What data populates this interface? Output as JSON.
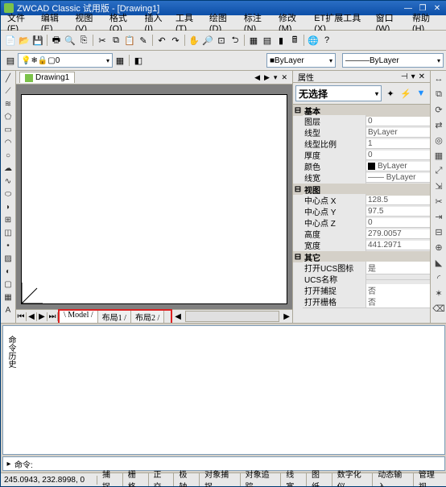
{
  "title": "ZWCAD Classic 试用版 - [Drawing1]",
  "menus": [
    "文件(F)",
    "编辑(E)",
    "视图(V)",
    "格式(O)",
    "插入(I)",
    "工具(T)",
    "绘图(D)",
    "标注(N)",
    "修改(M)",
    "ET扩展工具(X)",
    "窗口(W)",
    "帮助(H)"
  ],
  "layer_combo": "0",
  "bylayer1": "ByLayer",
  "bylayer2": "ByLayer",
  "doc_tab": "Drawing1",
  "layout_tabs": [
    "Model",
    "布局1",
    "布局2"
  ],
  "props_title": "属性",
  "selection": "无选择",
  "prop_groups": [
    {
      "name": "基本",
      "rows": [
        {
          "k": "图层",
          "v": "0"
        },
        {
          "k": "线型",
          "v": "ByLayer"
        },
        {
          "k": "线型比例",
          "v": "1"
        },
        {
          "k": "厚度",
          "v": "0"
        },
        {
          "k": "颜色",
          "v": "ByLayer",
          "sw": true
        },
        {
          "k": "线宽",
          "v": "—— ByLayer"
        }
      ]
    },
    {
      "name": "视图",
      "rows": [
        {
          "k": "中心点 X",
          "v": "128.5"
        },
        {
          "k": "中心点 Y",
          "v": "97.5"
        },
        {
          "k": "中心点 Z",
          "v": "0"
        },
        {
          "k": "高度",
          "v": "279.0057"
        },
        {
          "k": "宽度",
          "v": "441.2971"
        }
      ]
    },
    {
      "name": "其它",
      "rows": [
        {
          "k": "打开UCS图标",
          "v": "是"
        },
        {
          "k": "UCS名称",
          "v": ""
        },
        {
          "k": "打开捕捉",
          "v": "否"
        },
        {
          "k": "打开栅格",
          "v": "否"
        }
      ]
    }
  ],
  "cmd_vtext": "命令历史",
  "cmd_prompt": "命令:",
  "coords": "245.0943, 232.8998, 0",
  "status_btns": [
    "捕捉",
    "栅格",
    "正交",
    "极轴",
    "对象捕捉",
    "对象追踪",
    "线宽",
    "图纸",
    "数字化仪",
    "动态输入",
    "管理视"
  ]
}
